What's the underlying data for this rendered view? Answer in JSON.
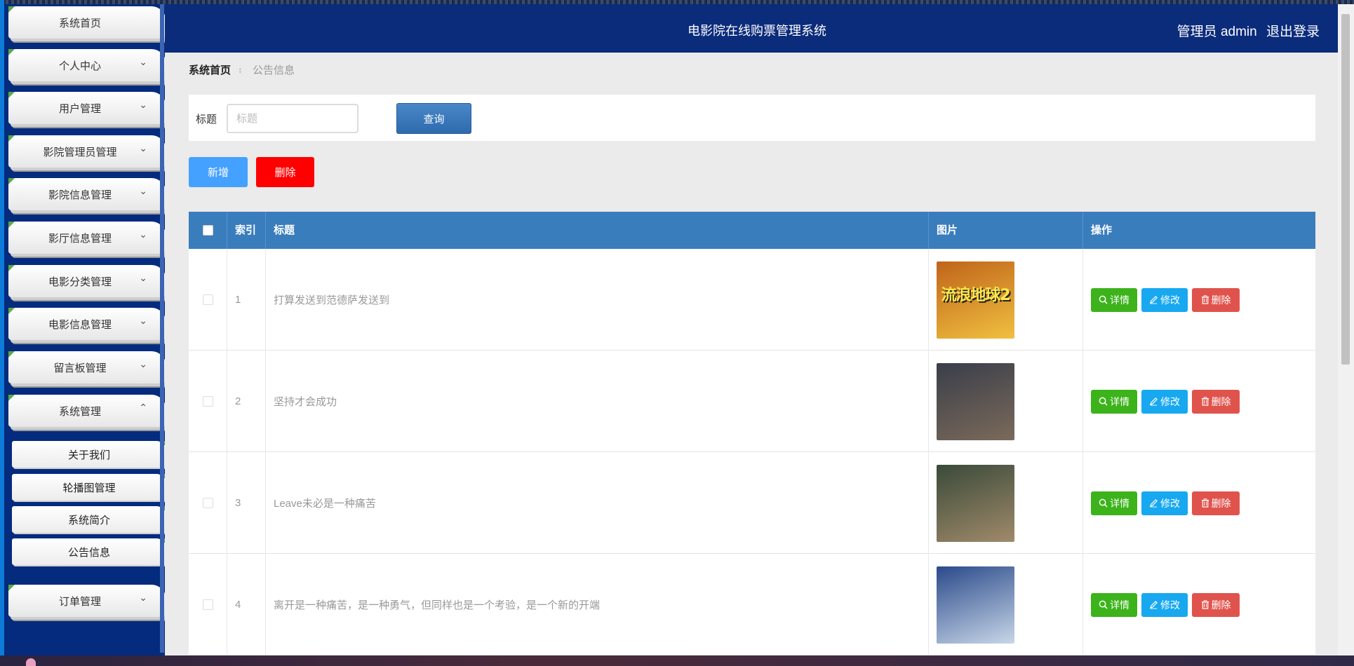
{
  "header": {
    "title": "电影院在线购票管理系统",
    "user_label": "管理员 admin",
    "logout_label": "退出登录"
  },
  "sidebar": {
    "items": [
      {
        "label": "系统首页",
        "chevron": ""
      },
      {
        "label": "个人中心",
        "chevron": "⌄"
      },
      {
        "label": "用户管理",
        "chevron": "⌄"
      },
      {
        "label": "影院管理员管理",
        "chevron": "⌄"
      },
      {
        "label": "影院信息管理",
        "chevron": "⌄"
      },
      {
        "label": "影厅信息管理",
        "chevron": "⌄"
      },
      {
        "label": "电影分类管理",
        "chevron": "⌄"
      },
      {
        "label": "电影信息管理",
        "chevron": "⌄"
      },
      {
        "label": "留言板管理",
        "chevron": "⌄"
      },
      {
        "label": "系统管理",
        "chevron": "⌃"
      }
    ],
    "sub_items": [
      {
        "label": "关于我们"
      },
      {
        "label": "轮播图管理"
      },
      {
        "label": "系统简介"
      },
      {
        "label": "公告信息"
      }
    ],
    "last_item": {
      "label": "订单管理",
      "chevron": "⌄"
    }
  },
  "breadcrumb": {
    "home": "系统首页",
    "separator": "⠆",
    "current": "公告信息"
  },
  "search": {
    "label": "标题",
    "placeholder": "标题",
    "value": "",
    "button": "查询"
  },
  "actions": {
    "add": "新增",
    "delete": "删除"
  },
  "table": {
    "columns": {
      "index": "索引",
      "title": "标题",
      "image": "图片",
      "ops": "操作"
    },
    "rows": [
      {
        "index": "1",
        "title": "打算发送到范德萨发送到",
        "poster_text": "流浪地球2",
        "poster_colors": [
          "#c0641a",
          "#f0c040"
        ]
      },
      {
        "index": "2",
        "title": "坚持才会成功",
        "poster_text": "",
        "poster_colors": [
          "#3a3e4a",
          "#7a6a5a"
        ]
      },
      {
        "index": "3",
        "title": "Leave未必是一种痛苦",
        "poster_text": "",
        "poster_colors": [
          "#3a4a3a",
          "#a08a6a"
        ]
      },
      {
        "index": "4",
        "title": "离开是一种痛苦，是一种勇气，但同样也是一个考验，是一个新的开端",
        "poster_text": "",
        "poster_colors": [
          "#2a4a8a",
          "#c8d6e8"
        ]
      }
    ],
    "op_labels": {
      "detail": "详情",
      "edit": "修改",
      "remove": "删除"
    }
  },
  "colors": {
    "header_bg": "#0b2b7b",
    "sidebar_bg": "#042b7e",
    "table_head": "#3a7dbd",
    "add_button": "#45a1ff",
    "delete_button": "#ff0000",
    "detail_button": "#3cb31b",
    "edit_button": "#17a8f0",
    "remove_button": "#e0534d"
  }
}
